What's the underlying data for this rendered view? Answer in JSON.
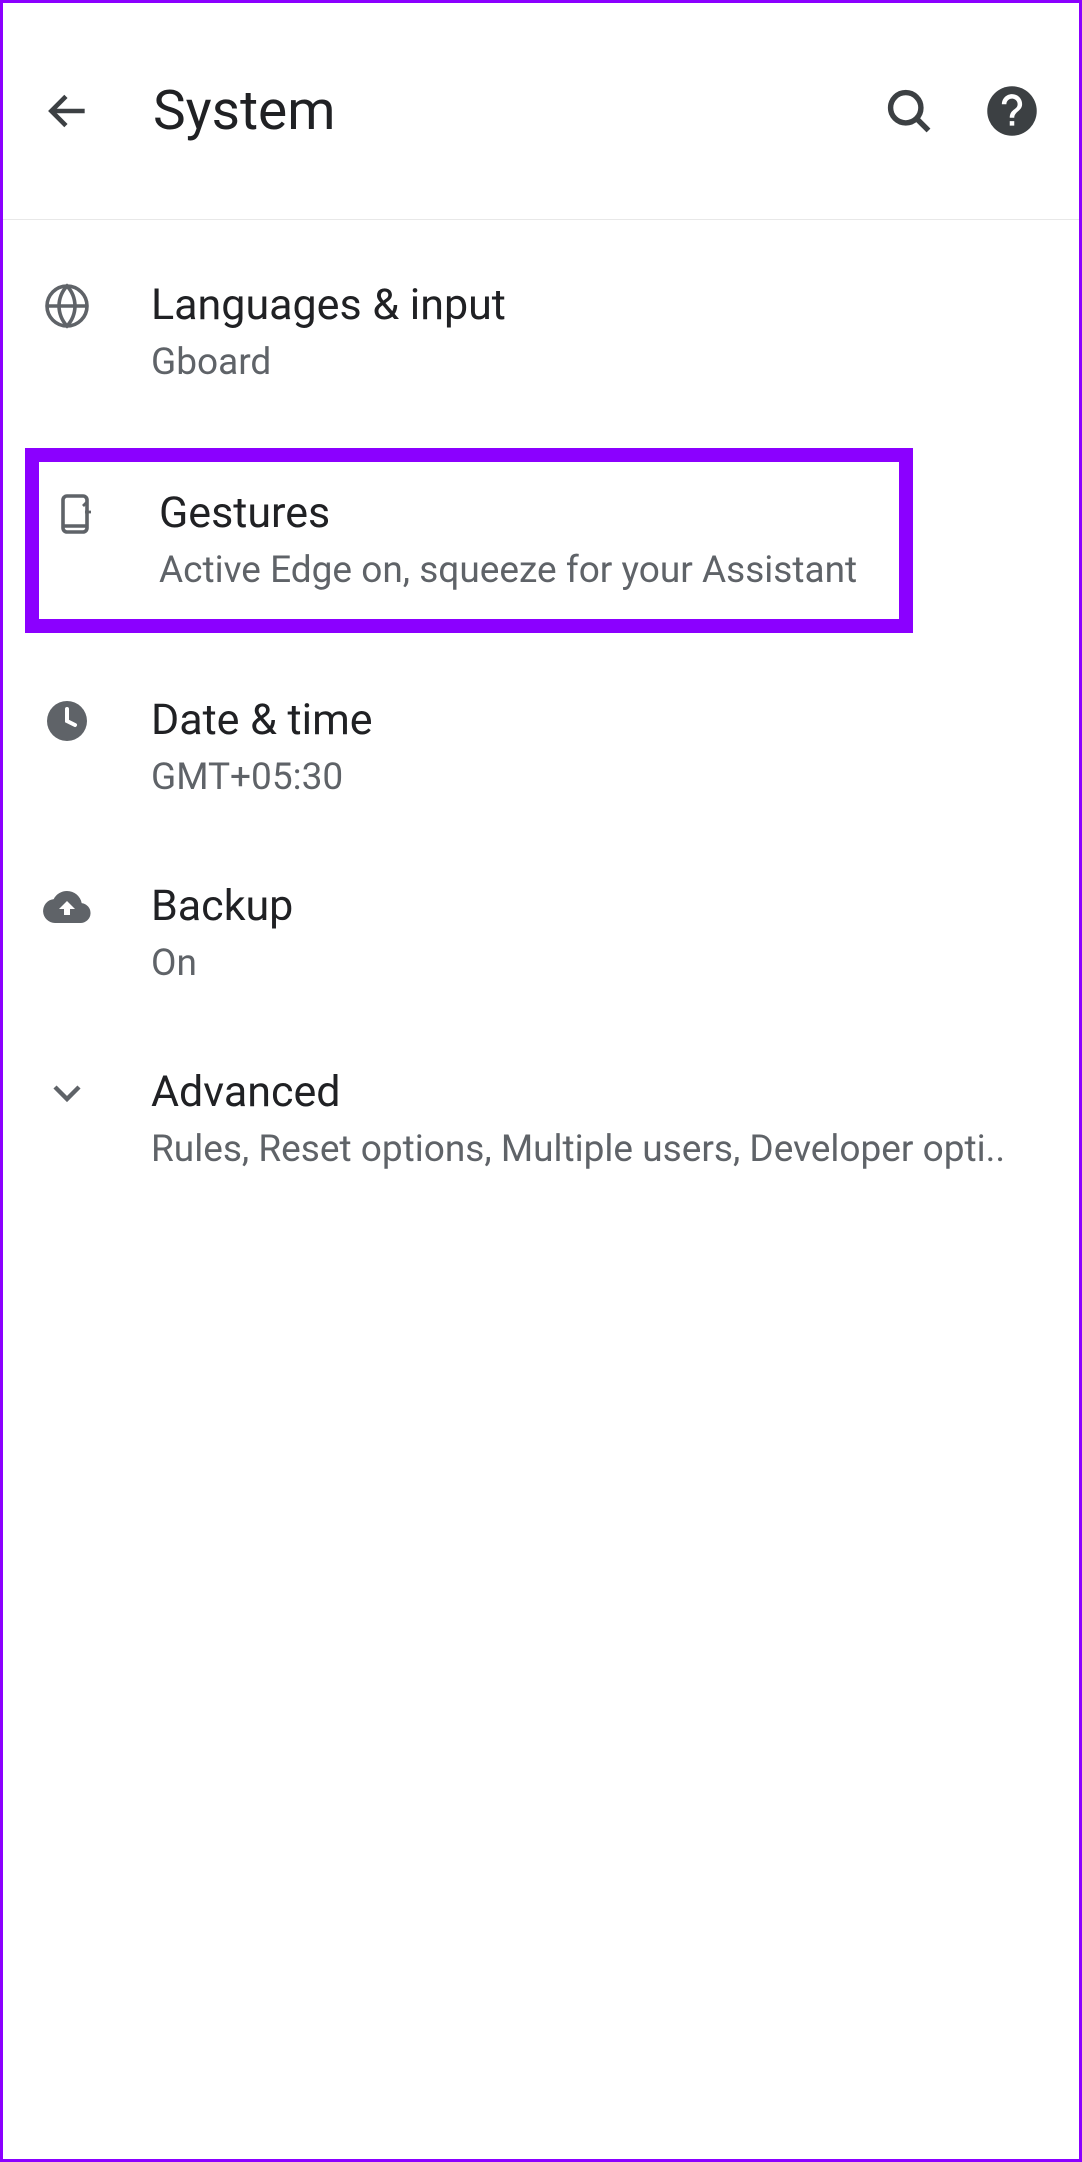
{
  "header": {
    "title": "System"
  },
  "items": [
    {
      "title": "Languages & input",
      "subtitle": "Gboard"
    },
    {
      "title": "Gestures",
      "subtitle": "Active Edge on, squeeze for your Assistant"
    },
    {
      "title": "Date & time",
      "subtitle": "GMT+05:30"
    },
    {
      "title": "Backup",
      "subtitle": "On"
    },
    {
      "title": "Advanced",
      "subtitle": "Rules, Reset options, Multiple users, Developer opti.."
    }
  ]
}
